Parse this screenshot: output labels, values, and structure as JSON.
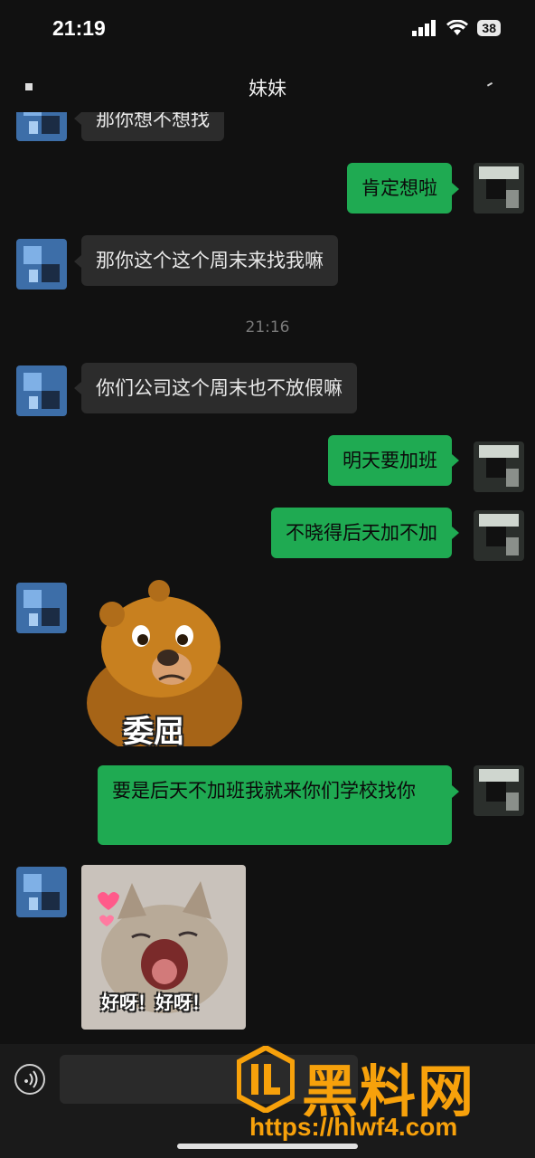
{
  "status_bar": {
    "time": "21:19",
    "battery": "38"
  },
  "header": {
    "title": "妹妹"
  },
  "messages": [
    {
      "side": "in",
      "text": "那你想不想找"
    },
    {
      "side": "out",
      "text": "肯定想啦"
    },
    {
      "side": "in",
      "text": "那你这个这个周末来找我嘛"
    },
    {
      "timestamp": "21:16"
    },
    {
      "side": "in",
      "text": "你们公司这个周末也不放假嘛"
    },
    {
      "side": "out",
      "text": "明天要加班"
    },
    {
      "side": "out",
      "text": "不晓得后天加不加"
    },
    {
      "side": "in",
      "sticker": "bear-sticker",
      "caption": "委屈"
    },
    {
      "side": "out",
      "text": "要是后天不加班我就来你们学校找你"
    },
    {
      "side": "in",
      "sticker": "cat-sticker",
      "caption": "好呀！好呀！"
    }
  ],
  "watermark": {
    "title": "黑料网",
    "url": "https://hlwf4.com"
  },
  "colors": {
    "background": "#111111",
    "bubble_in": "#2c2c2c",
    "bubble_out": "#1faa52",
    "watermark": "#f7a10b"
  }
}
